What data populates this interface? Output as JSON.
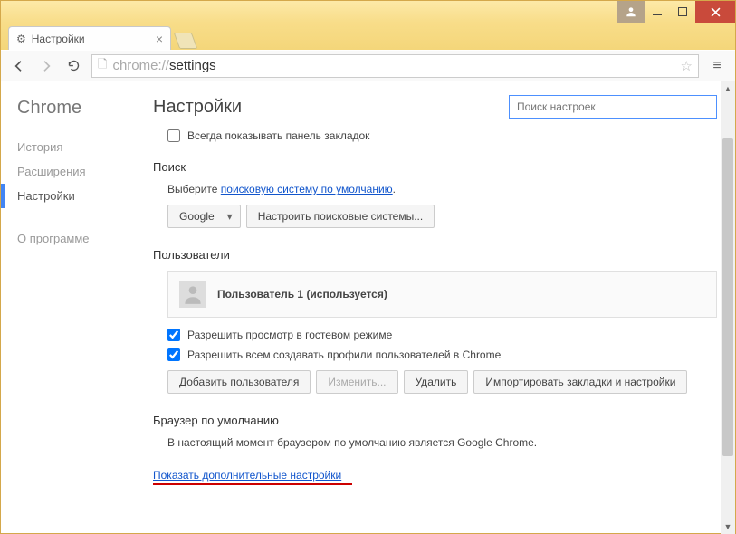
{
  "window": {
    "tab_title": "Настройки"
  },
  "address": {
    "scheme": "chrome://",
    "path": "settings"
  },
  "sidebar": {
    "logo": "Chrome",
    "items": [
      {
        "label": "История",
        "active": false
      },
      {
        "label": "Расширения",
        "active": false
      },
      {
        "label": "Настройки",
        "active": true
      }
    ],
    "about": "О программе"
  },
  "main": {
    "title": "Настройки",
    "search_placeholder": "Поиск настроек"
  },
  "bookmarks": {
    "always_show": "Всегда показывать панель закладок",
    "checked": false
  },
  "search": {
    "title": "Поиск",
    "prompt_prefix": "Выберите ",
    "prompt_link": "поисковую систему по умолчанию",
    "prompt_suffix": ".",
    "engine_selected": "Google",
    "manage_button": "Настроить поисковые системы..."
  },
  "users": {
    "title": "Пользователи",
    "current": "Пользователь 1 (используется)",
    "guest_browsing": {
      "label": "Разрешить просмотр в гостевом режиме",
      "checked": true
    },
    "allow_create": {
      "label": "Разрешить всем создавать профили пользователей в Chrome",
      "checked": true
    },
    "add_button": "Добавить пользователя",
    "edit_button": "Изменить...",
    "delete_button": "Удалить",
    "import_button": "Импортировать закладки и настройки"
  },
  "default_browser": {
    "title": "Браузер по умолчанию",
    "status": "В настоящий момент браузером по умолчанию является Google Chrome."
  },
  "advanced": {
    "link": "Показать дополнительные настройки"
  }
}
